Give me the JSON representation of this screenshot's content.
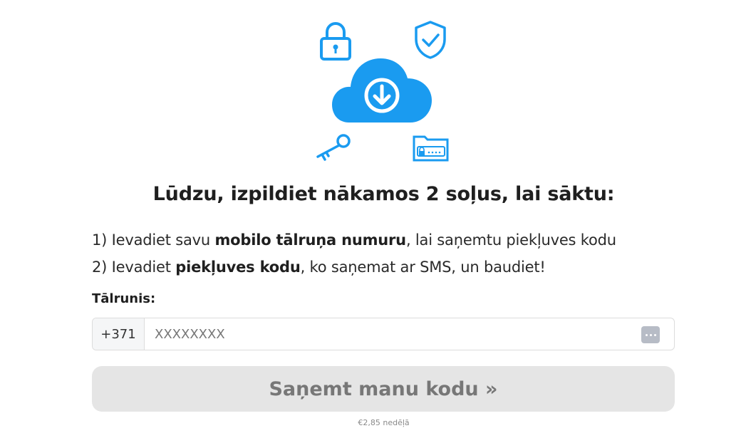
{
  "hero": {
    "icons": [
      "padlock-icon",
      "shield-check-icon",
      "cloud-download-icon",
      "key-icon",
      "password-folder-icon"
    ],
    "accent_color": "#1a9bf0"
  },
  "headline": "Lūdzu, izpildiet nākamos 2 soļus, lai sāktu:",
  "steps": {
    "step1": {
      "prefix": "1) Ievadiet savu ",
      "bold": "mobilo tālruņa numuru",
      "suffix": ", lai saņemtu piekļuves kodu"
    },
    "step2": {
      "prefix": "2) Ievadiet ",
      "bold": "piekļuves kodu",
      "suffix": ", ko saņemat ar SMS, un baudiet!"
    }
  },
  "form": {
    "phone_label": "Tālrunis:",
    "country_code": "+371",
    "phone_placeholder": "XXXXXXXX",
    "phone_value": "",
    "submit_label": "Saņemt manu kodu »",
    "submit_bg": "#e5e5e5",
    "submit_text_color": "#777777"
  },
  "price_note": "€2,85 nedēļā"
}
